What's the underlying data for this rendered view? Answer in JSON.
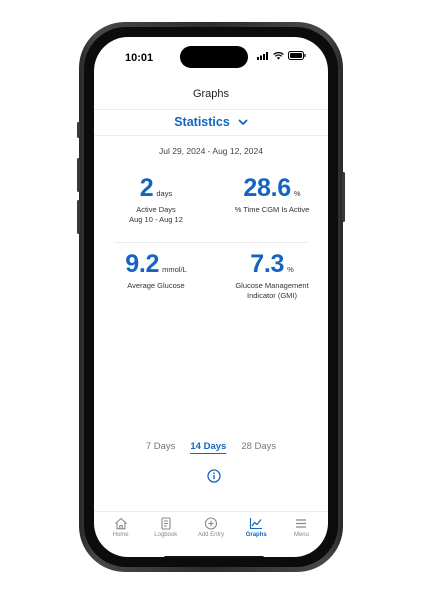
{
  "status_bar": {
    "time": "10:01"
  },
  "header": {
    "title": "Graphs"
  },
  "selector": {
    "label": "Statistics"
  },
  "date_range": "Jul 29, 2024 - Aug 12, 2024",
  "stats": {
    "active_days": {
      "value": "2",
      "unit": "days",
      "label_line1": "Active Days",
      "label_line2": "Aug 10 - Aug 12"
    },
    "time_cgm": {
      "value": "28.6",
      "unit": "%",
      "label_line1": "% Time CGM Is Active"
    },
    "avg_glucose": {
      "value": "9.2",
      "unit": "mmol/L",
      "label_line1": "Average Glucose"
    },
    "gmi": {
      "value": "7.3",
      "unit": "%",
      "label_line1": "Glucose Management",
      "label_line2": "Indicator (GMI)"
    }
  },
  "range_tabs": {
    "items": [
      "7 Days",
      "14 Days",
      "28 Days"
    ],
    "selected": "14 Days"
  },
  "tab_bar": {
    "items": [
      {
        "label": "Home",
        "icon": "home-icon"
      },
      {
        "label": "Logbook",
        "icon": "logbook-icon"
      },
      {
        "label": "Add Entry",
        "icon": "add-entry-icon"
      },
      {
        "label": "Graphs",
        "icon": "graphs-icon"
      },
      {
        "label": "Menu",
        "icon": "menu-icon"
      }
    ],
    "active": "Graphs"
  },
  "colors": {
    "accent": "#1565c0",
    "text": "#333333",
    "muted": "#888888"
  }
}
